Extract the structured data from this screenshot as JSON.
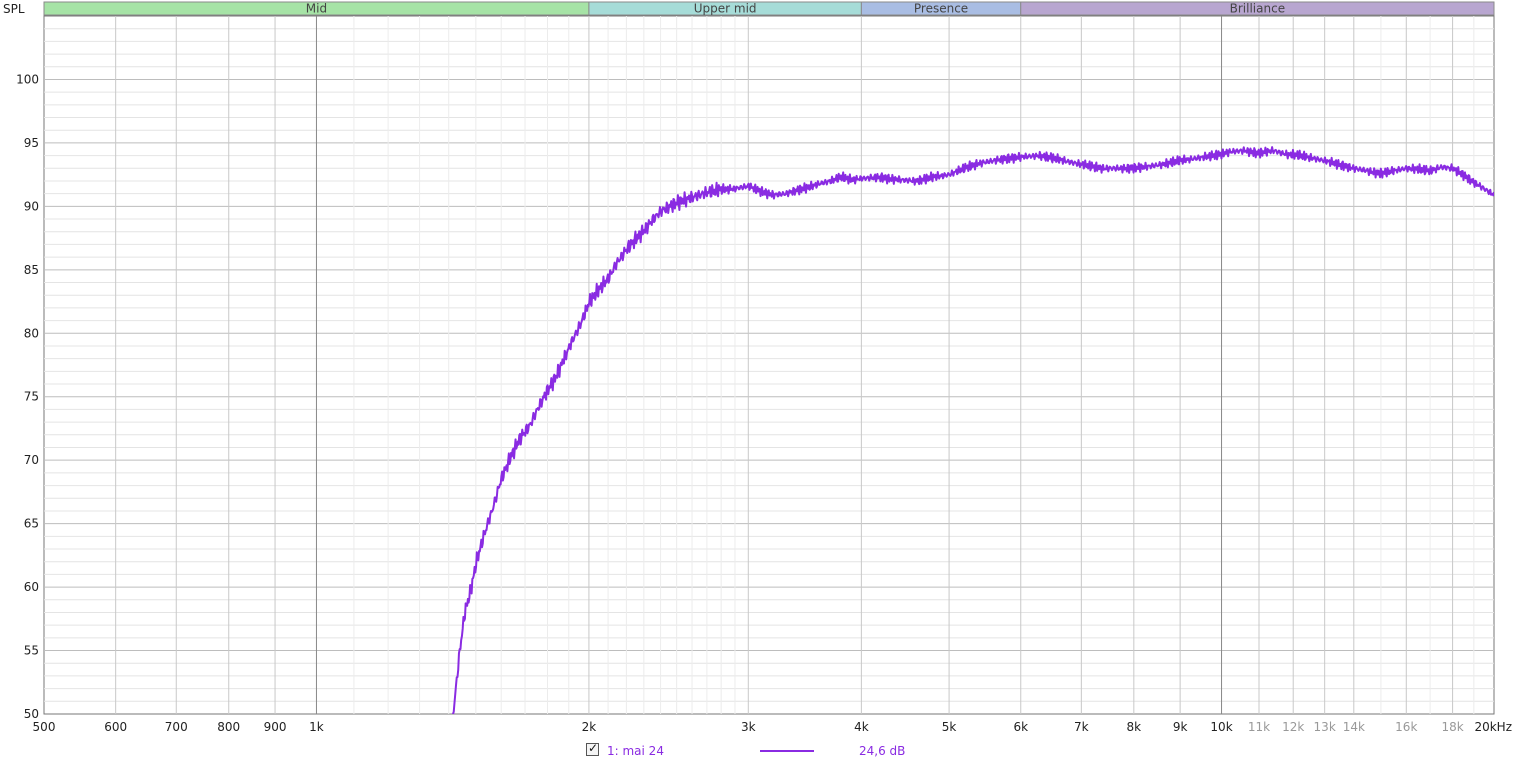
{
  "chart_data": {
    "type": "line",
    "ylabel": "SPL",
    "xunit": "kHz",
    "x_scale": "log",
    "xlim": [
      500,
      20000
    ],
    "ylim": [
      50,
      105
    ],
    "grid": true,
    "y_ticks": [
      50,
      55,
      60,
      65,
      70,
      75,
      80,
      85,
      90,
      95,
      100
    ],
    "x_ticks": [
      {
        "v": 500,
        "label": "500"
      },
      {
        "v": 600,
        "label": "600"
      },
      {
        "v": 700,
        "label": "700"
      },
      {
        "v": 800,
        "label": "800"
      },
      {
        "v": 900,
        "label": "900"
      },
      {
        "v": 1000,
        "label": "1k"
      },
      {
        "v": 2000,
        "label": "2k"
      },
      {
        "v": 3000,
        "label": "3k"
      },
      {
        "v": 4000,
        "label": "4k"
      },
      {
        "v": 5000,
        "label": "5k"
      },
      {
        "v": 6000,
        "label": "6k"
      },
      {
        "v": 7000,
        "label": "7k"
      },
      {
        "v": 8000,
        "label": "8k"
      },
      {
        "v": 9000,
        "label": "9k"
      },
      {
        "v": 10000,
        "label": "10k"
      },
      {
        "v": 11000,
        "label": "11k",
        "faint": true
      },
      {
        "v": 12000,
        "label": "12k",
        "faint": true
      },
      {
        "v": 13000,
        "label": "13k",
        "faint": true
      },
      {
        "v": 14000,
        "label": "14k",
        "faint": true
      },
      {
        "v": 16000,
        "label": "16k",
        "faint": true
      },
      {
        "v": 18000,
        "label": "18k",
        "faint": true
      },
      {
        "v": 20000,
        "label": "20kHz"
      }
    ],
    "bands": [
      {
        "name": "Mid",
        "from": 500,
        "to": 2000,
        "color": "#a6e3a6"
      },
      {
        "name": "Upper mid",
        "from": 2000,
        "to": 4000,
        "color": "#a6dcd8"
      },
      {
        "name": "Presence",
        "from": 4000,
        "to": 6000,
        "color": "#a9bde3"
      },
      {
        "name": "Brilliance",
        "from": 6000,
        "to": 20000,
        "color": "#b8a6d0"
      }
    ],
    "series": [
      {
        "name": "1: mai 24",
        "offset_label": "24,6 dB",
        "color": "#8a2be2",
        "points": [
          [
            1410,
            49
          ],
          [
            1420,
            50.8
          ],
          [
            1440,
            55
          ],
          [
            1460,
            58.2
          ],
          [
            1480,
            59.6
          ],
          [
            1500,
            61.8
          ],
          [
            1530,
            64
          ],
          [
            1560,
            65.8
          ],
          [
            1600,
            68.5
          ],
          [
            1640,
            70.3
          ],
          [
            1680,
            71.8
          ],
          [
            1720,
            72.7
          ],
          [
            1760,
            74.2
          ],
          [
            1800,
            75.5
          ],
          [
            1840,
            76.6
          ],
          [
            1880,
            78.1
          ],
          [
            1920,
            79.5
          ],
          [
            1960,
            80.8
          ],
          [
            2000,
            82.4
          ],
          [
            2050,
            83.4
          ],
          [
            2100,
            84.3
          ],
          [
            2150,
            85.6
          ],
          [
            2200,
            86.6
          ],
          [
            2250,
            87.4
          ],
          [
            2300,
            88.1
          ],
          [
            2350,
            88.9
          ],
          [
            2400,
            89.6
          ],
          [
            2500,
            90.3
          ],
          [
            2600,
            90.7
          ],
          [
            2700,
            91.1
          ],
          [
            2800,
            91.3
          ],
          [
            2900,
            91.4
          ],
          [
            3000,
            91.6
          ],
          [
            3100,
            91.2
          ],
          [
            3200,
            90.9
          ],
          [
            3300,
            91.0
          ],
          [
            3400,
            91.3
          ],
          [
            3500,
            91.5
          ],
          [
            3600,
            91.8
          ],
          [
            3700,
            92.0
          ],
          [
            3800,
            92.3
          ],
          [
            3900,
            92.1
          ],
          [
            4000,
            92.2
          ],
          [
            4200,
            92.3
          ],
          [
            4400,
            92.1
          ],
          [
            4600,
            92.0
          ],
          [
            4800,
            92.3
          ],
          [
            5000,
            92.5
          ],
          [
            5200,
            93.0
          ],
          [
            5400,
            93.4
          ],
          [
            5600,
            93.6
          ],
          [
            5800,
            93.8
          ],
          [
            6000,
            93.9
          ],
          [
            6300,
            94.0
          ],
          [
            6600,
            93.7
          ],
          [
            7000,
            93.3
          ],
          [
            7400,
            93.0
          ],
          [
            7800,
            93.0
          ],
          [
            8200,
            93.1
          ],
          [
            8600,
            93.3
          ],
          [
            9000,
            93.6
          ],
          [
            9400,
            93.8
          ],
          [
            9800,
            94.0
          ],
          [
            10200,
            94.3
          ],
          [
            10600,
            94.4
          ],
          [
            11000,
            94.2
          ],
          [
            11400,
            94.4
          ],
          [
            11800,
            94.1
          ],
          [
            12200,
            94.0
          ],
          [
            12600,
            93.8
          ],
          [
            13000,
            93.6
          ],
          [
            13500,
            93.3
          ],
          [
            14000,
            93.0
          ],
          [
            14500,
            92.8
          ],
          [
            15000,
            92.6
          ],
          [
            15500,
            92.8
          ],
          [
            16000,
            93.0
          ],
          [
            16500,
            92.9
          ],
          [
            17000,
            92.8
          ],
          [
            17500,
            93.1
          ],
          [
            18000,
            93.0
          ],
          [
            18500,
            92.5
          ],
          [
            19000,
            91.9
          ],
          [
            19500,
            91.4
          ],
          [
            20000,
            90.9
          ]
        ]
      }
    ]
  }
}
